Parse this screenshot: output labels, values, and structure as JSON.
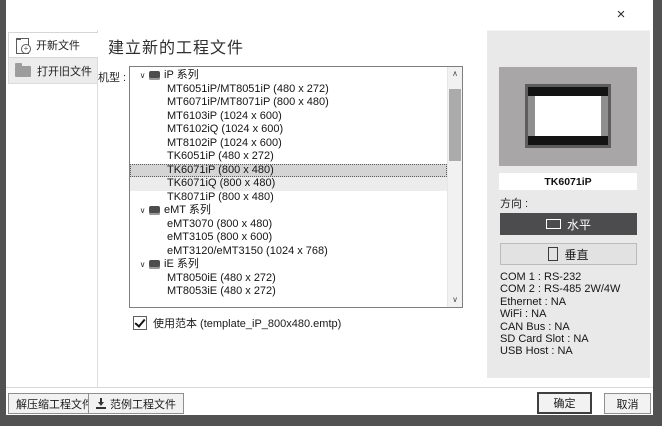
{
  "window": {
    "close_glyph": "×"
  },
  "sidebar": {
    "items": [
      {
        "label": "开新文件"
      },
      {
        "label": "打开旧文件"
      }
    ]
  },
  "header": {
    "title": "建立新的工程文件"
  },
  "model": {
    "label": "机型 :",
    "tree": [
      {
        "type": "group",
        "label": "iP 系列"
      },
      {
        "type": "item",
        "label": "MT6051iP/MT8051iP (480 x 272)"
      },
      {
        "type": "item",
        "label": "MT6071iP/MT8071iP (800 x 480)"
      },
      {
        "type": "item",
        "label": "MT6103iP (1024 x 600)"
      },
      {
        "type": "item",
        "label": "MT6102iQ (1024 x 600)"
      },
      {
        "type": "item",
        "label": "MT8102iP (1024 x 600)"
      },
      {
        "type": "item",
        "label": "TK6051iP (480 x 272)"
      },
      {
        "type": "item",
        "label": "TK6071iP (800 x 480)",
        "state": "selected"
      },
      {
        "type": "item",
        "label": "TK6071iQ (800 x 480)",
        "state": "soft"
      },
      {
        "type": "item",
        "label": "TK8071iP (800 x 480)"
      },
      {
        "type": "group",
        "label": "eMT 系列"
      },
      {
        "type": "item",
        "label": "eMT3070 (800 x 480)"
      },
      {
        "type": "item",
        "label": "eMT3105 (800 x 600)"
      },
      {
        "type": "item",
        "label": "eMT3120/eMT3150 (1024 x 768)"
      },
      {
        "type": "group",
        "label": "iE 系列"
      },
      {
        "type": "item",
        "label": "MT8050iE (480 x 272)"
      },
      {
        "type": "item",
        "label": "MT8053iE (480 x 272)"
      }
    ],
    "chevron_glyph": "∨",
    "scroll_up_glyph": "∧",
    "scroll_down_glyph": "∨"
  },
  "template_option": {
    "checked": true,
    "label": "使用范本 (template_iP_800x480.emtp)"
  },
  "preview": {
    "model_name": "TK6071iP"
  },
  "orientation": {
    "label": "方向 :",
    "horizontal_label": "水平",
    "vertical_label": "垂直",
    "selected": "horizontal"
  },
  "ports": {
    "lines": [
      "COM 1 : RS-232",
      "COM 2 : RS-485 2W/4W",
      "Ethernet : NA",
      "WiFi : NA",
      "CAN Bus : NA",
      "SD Card Slot : NA",
      "USB Host : NA"
    ]
  },
  "footer": {
    "decompress_label": "解压缩工程文件",
    "example_label": "范例工程文件",
    "ok_label": "确定",
    "cancel_label": "取消"
  },
  "colors": {
    "selected_row": "#d4d4d4",
    "horizontal_button": "#4c4c4e",
    "panel_bg": "#e9e9e9",
    "window_edge": "#525252"
  }
}
